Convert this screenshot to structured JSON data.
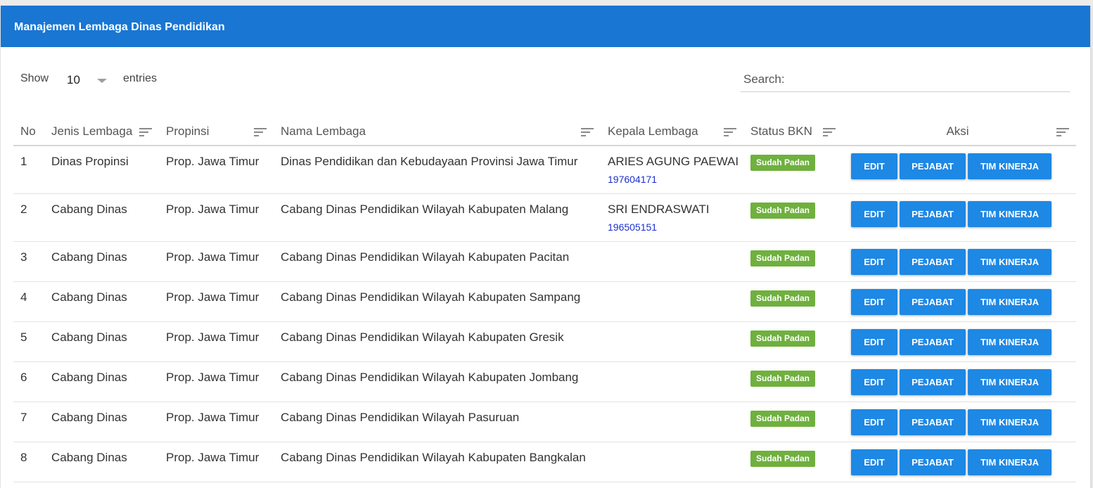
{
  "header": {
    "title": "Manajemen Lembaga Dinas Pendidikan"
  },
  "controls": {
    "show_label": "Show",
    "length_value": "10",
    "entries_label": "entries",
    "search_label": "Search:",
    "search_value": ""
  },
  "table": {
    "columns": [
      "No",
      "Jenis Lembaga",
      "Propinsi",
      "Nama Lembaga",
      "Kepala Lembaga",
      "Status BKN",
      "Aksi"
    ],
    "action_labels": {
      "edit": "EDIT",
      "pejabat": "PEJABAT",
      "tim": "TIM KINERJA"
    },
    "rows": [
      {
        "no": "1",
        "jenis": "Dinas Propinsi",
        "propinsi": "Prop. Jawa Timur",
        "nama": "Dinas Pendidikan dan Kebudayaan Provinsi Jawa Timur",
        "kepala": "ARIES AGUNG PAEWAI",
        "nip": "197604171",
        "status": "Sudah Padan"
      },
      {
        "no": "2",
        "jenis": "Cabang Dinas",
        "propinsi": "Prop. Jawa Timur",
        "nama": "Cabang Dinas Pendidikan Wilayah Kabupaten Malang",
        "kepala": "SRI ENDRASWATI",
        "nip": "196505151",
        "status": "Sudah Padan"
      },
      {
        "no": "3",
        "jenis": "Cabang Dinas",
        "propinsi": "Prop. Jawa Timur",
        "nama": "Cabang Dinas Pendidikan Wilayah Kabupaten Pacitan",
        "kepala": "",
        "nip": "",
        "status": "Sudah Padan"
      },
      {
        "no": "4",
        "jenis": "Cabang Dinas",
        "propinsi": "Prop. Jawa Timur",
        "nama": "Cabang Dinas Pendidikan Wilayah Kabupaten Sampang",
        "kepala": "",
        "nip": "",
        "status": "Sudah Padan"
      },
      {
        "no": "5",
        "jenis": "Cabang Dinas",
        "propinsi": "Prop. Jawa Timur",
        "nama": "Cabang Dinas Pendidikan Wilayah Kabupaten Gresik",
        "kepala": "",
        "nip": "",
        "status": "Sudah Padan"
      },
      {
        "no": "6",
        "jenis": "Cabang Dinas",
        "propinsi": "Prop. Jawa Timur",
        "nama": "Cabang Dinas Pendidikan Wilayah Kabupaten Jombang",
        "kepala": "",
        "nip": "",
        "status": "Sudah Padan"
      },
      {
        "no": "7",
        "jenis": "Cabang Dinas",
        "propinsi": "Prop. Jawa Timur",
        "nama": "Cabang Dinas Pendidikan Wilayah Pasuruan",
        "kepala": "",
        "nip": "",
        "status": "Sudah Padan"
      },
      {
        "no": "8",
        "jenis": "Cabang Dinas",
        "propinsi": "Prop. Jawa Timur",
        "nama": "Cabang Dinas Pendidikan Wilayah Kabupaten Bangkalan",
        "kepala": "",
        "nip": "",
        "status": "Sudah Padan"
      }
    ]
  },
  "colors": {
    "header_bg": "#1976d2",
    "button_bg": "#1e88e5",
    "badge_bg": "#6fb03e",
    "nip_text": "#1a2fd0"
  },
  "icons": {
    "sort": "sort-lines-icon",
    "dropdown": "caret-down-icon"
  }
}
